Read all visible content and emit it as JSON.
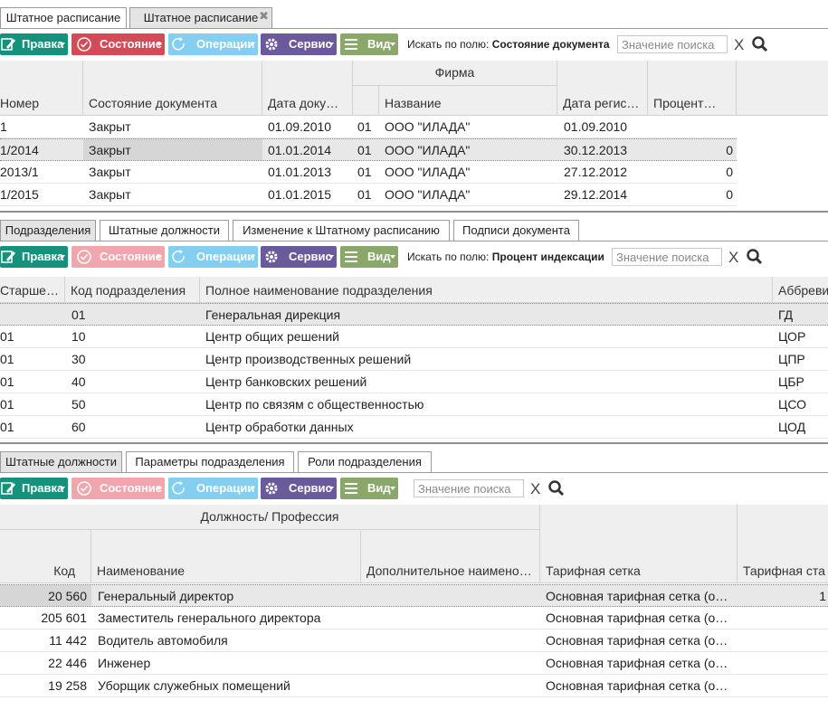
{
  "main_tabs": [
    "Штатное расписание",
    "Штатное расписание"
  ],
  "toolbar": {
    "edit": "Правка",
    "state": "Состояние",
    "ops": "Операции",
    "service": "Сервис",
    "view": "Вид",
    "search_by": "Искать по полю:",
    "search_placeholder": "Значение поиска",
    "clear": "X"
  },
  "doc_grid": {
    "search_field": "Состояние документа",
    "group_firm": "Фирма",
    "headers": [
      "Номер",
      "Состояние документа",
      "Дата доку…",
      "",
      "Название",
      "Дата регис…",
      "Процент…"
    ],
    "rows": [
      [
        "1",
        "Закрыт",
        "01.09.2010",
        "01",
        "ООО \"ИЛАДА\"",
        "01.09.2010",
        ""
      ],
      [
        "1/2014",
        "Закрыт",
        "01.01.2014",
        "01",
        "ООО \"ИЛАДА\"",
        "30.12.2013",
        "0"
      ],
      [
        "2013/1",
        "Закрыт",
        "01.01.2013",
        "01",
        "ООО \"ИЛАДА\"",
        "27.12.2012",
        "0"
      ],
      [
        "1/2015",
        "Закрыт",
        "01.01.2015",
        "01",
        "ООО \"ИЛАДА\"",
        "29.12.2014",
        "0"
      ]
    ]
  },
  "sub_tabs": [
    "Подразделения",
    "Штатные должности",
    "Изменение к Штатному расписанию",
    "Подписи документа"
  ],
  "dept_grid": {
    "search_field": "Процент индексации",
    "headers": [
      "Старше…",
      "Код подразделения",
      "Полное наименование подразделения",
      "Аббреви"
    ],
    "rows": [
      [
        "",
        "01",
        "Генеральная дирекция",
        "ГД"
      ],
      [
        "01",
        "10",
        "Центр общих решений",
        "ЦОР"
      ],
      [
        "01",
        "30",
        "Центр производственных решений",
        "ЦПР"
      ],
      [
        "01",
        "40",
        "Центр банковских решений",
        "ЦБР"
      ],
      [
        "01",
        "50",
        "Центр по связям с общественностью",
        "ЦСО"
      ],
      [
        "01",
        "60",
        "Центр обработки данных",
        "ЦОД"
      ]
    ]
  },
  "pos_tabs": [
    "Штатные должности",
    "Параметры подразделения",
    "Роли подразделения"
  ],
  "pos_grid": {
    "group_position": "Должность/ Профессия",
    "headers": [
      "Код",
      "Наименование",
      "Дополнительное наимено…",
      "Тарифная сетка",
      "Тарифная ста"
    ],
    "rows": [
      [
        "20 560",
        "Генеральный директор",
        "",
        "Основная тарифная сетка (о…",
        "1"
      ],
      [
        "205 601",
        "Заместитель генерального директора",
        "",
        "Основная тарифная сетка (о…",
        ""
      ],
      [
        "11 442",
        "Водитель автомобиля",
        "",
        "Основная тарифная сетка (о…",
        ""
      ],
      [
        "22 446",
        "Инженер",
        "",
        "Основная тарифная сетка (о…",
        ""
      ],
      [
        "19 258",
        "Уборщик служебных помещений",
        "",
        "Основная тарифная сетка (о…",
        ""
      ]
    ]
  }
}
